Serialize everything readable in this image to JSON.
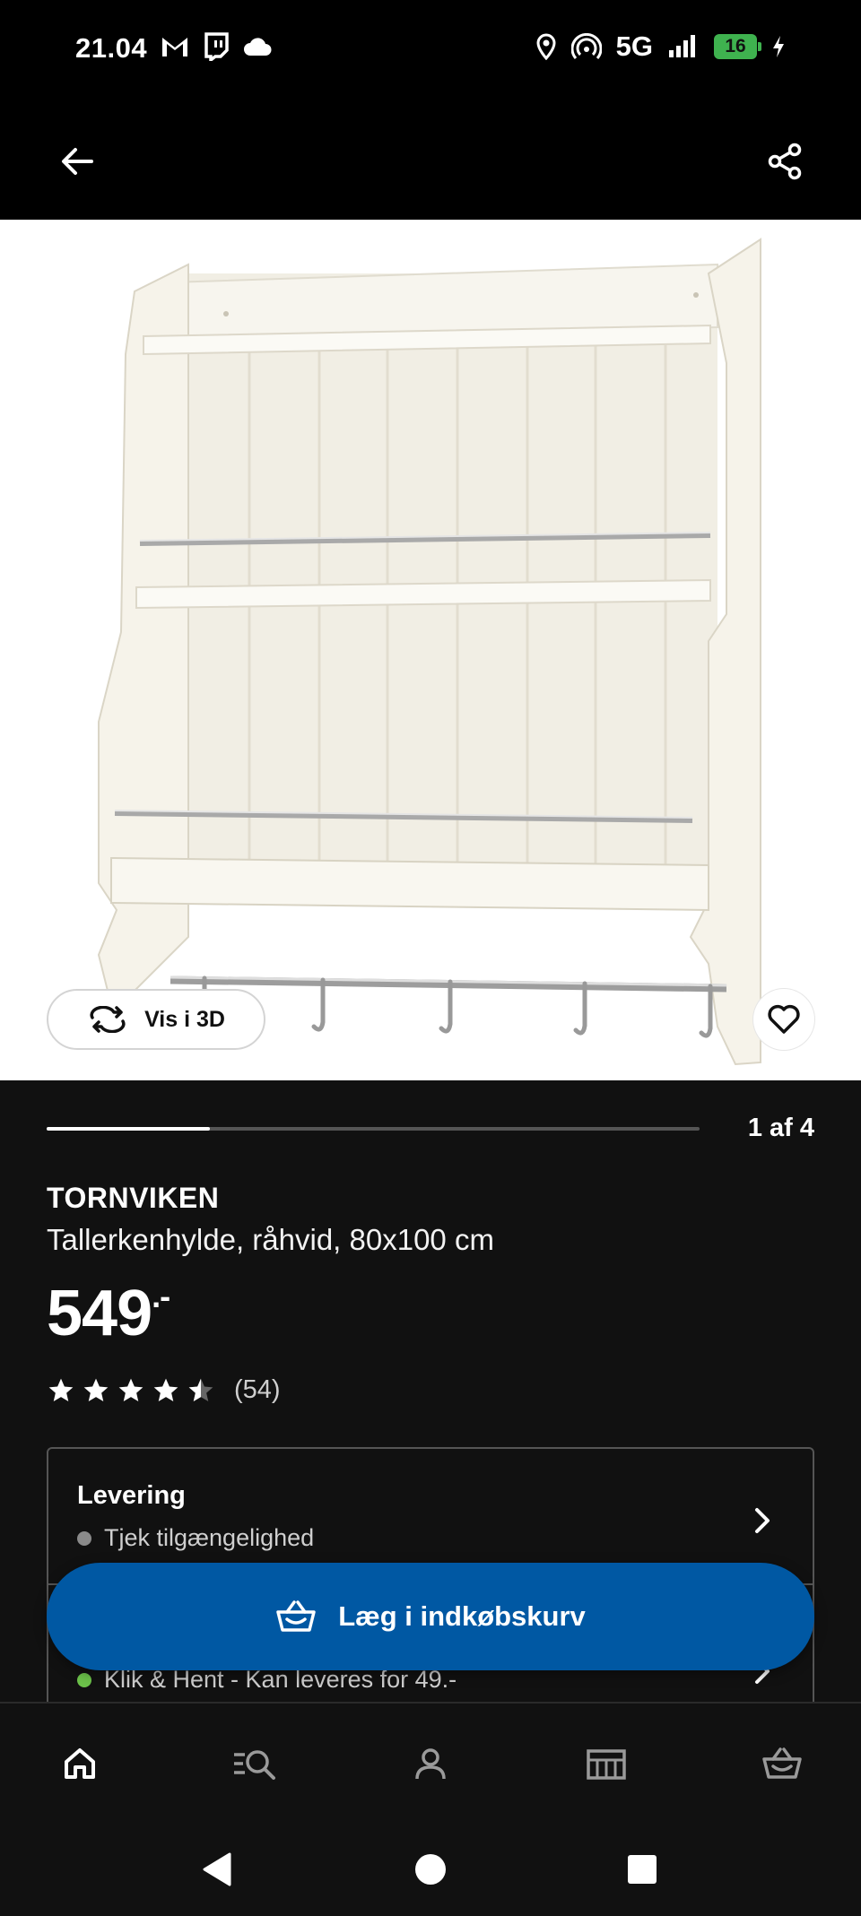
{
  "status_bar": {
    "time": "21.04",
    "network": "5G",
    "battery": "16"
  },
  "app_bar": {
    "back_icon": "arrow-left-icon",
    "share_icon": "share-icon"
  },
  "product_image": {
    "view_3d_label": "Vis i 3D",
    "favorite_icon": "heart-icon"
  },
  "carousel": {
    "progress": 0.25,
    "counter": "1 af 4"
  },
  "product": {
    "name": "TORNVIKEN",
    "description": "Tallerkenhylde, råhvid, 80x100 cm",
    "price": "549",
    "price_suffix": ".-",
    "rating": 4.5,
    "review_count": "(54)"
  },
  "delivery": {
    "title": "Levering",
    "status": "Tjek tilgængelighed",
    "status_color": "#8a8a8a",
    "pickup_status": "Klik & Hent - Kan leveres for 49.-",
    "pickup_color": "#6cc24a"
  },
  "cta": {
    "label": "Læg i indkøbskurv",
    "color": "#0058a3"
  },
  "bottom_nav": {
    "items": [
      "home-icon",
      "search-icon",
      "profile-icon",
      "store-icon",
      "cart-icon"
    ]
  }
}
